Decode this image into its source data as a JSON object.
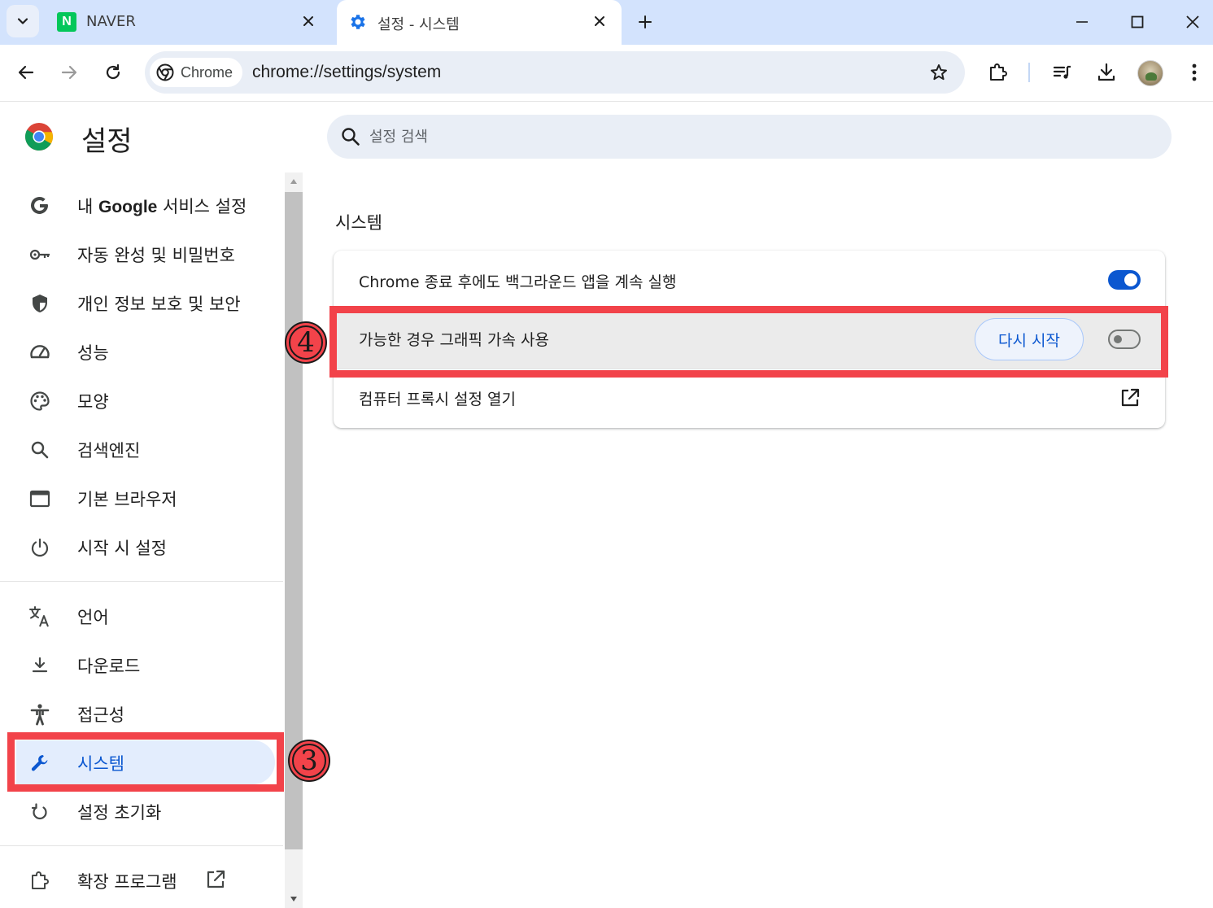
{
  "tabs": [
    {
      "title": "NAVER",
      "favicon": "naver-n-icon",
      "favicon_letter": "N",
      "active": false
    },
    {
      "title": "설정 - 시스템",
      "favicon": "gear-icon",
      "active": true
    }
  ],
  "toolbar": {
    "chip_label": "Chrome",
    "url": "chrome://settings/system"
  },
  "header": {
    "title": "설정",
    "search_placeholder": "설정 검색"
  },
  "sidebar": {
    "items": [
      {
        "label_bold": "내 ",
        "label_brand": "Google",
        "label_rest": " 서비스 설정",
        "icon": "google-g-icon"
      },
      {
        "label": "자동 완성 및 비밀번호",
        "icon": "key-icon"
      },
      {
        "label": "개인 정보 보호 및 보안",
        "icon": "shield-icon"
      },
      {
        "label": "성능",
        "icon": "speedometer-icon"
      },
      {
        "label": "모양",
        "icon": "palette-icon"
      },
      {
        "label": "검색엔진",
        "icon": "search-icon"
      },
      {
        "label": "기본 브라우저",
        "icon": "browser-window-icon"
      },
      {
        "label": "시작 시 설정",
        "icon": "power-icon"
      },
      {
        "label": "언어",
        "icon": "translate-icon"
      },
      {
        "label": "다운로드",
        "icon": "download-icon"
      },
      {
        "label": "접근성",
        "icon": "accessibility-icon"
      },
      {
        "label": "시스템",
        "icon": "wrench-icon",
        "selected": true
      },
      {
        "label": "설정 초기화",
        "icon": "reset-icon"
      },
      {
        "label": "확장 프로그램",
        "icon": "puzzle-icon",
        "external": true
      }
    ]
  },
  "main": {
    "section_title": "시스템",
    "rows": [
      {
        "label": "Chrome 종료 후에도 백그라운드 앱을 계속 실행",
        "control": "toggle",
        "checked": true
      },
      {
        "label": "가능한 경우 그래픽 가속 사용",
        "control": "toggle",
        "checked": false,
        "button_label": "다시 시작"
      },
      {
        "label": "컴퓨터 프록시 설정 열기",
        "control": "external-link-icon"
      }
    ]
  },
  "annotations": {
    "marker_3": "3",
    "marker_4": "4",
    "color": "#f2434a"
  },
  "colors": {
    "accent": "#0b57d0",
    "tabstrip": "#d3e3fd",
    "selected_nav_bg": "#e3edfd"
  }
}
